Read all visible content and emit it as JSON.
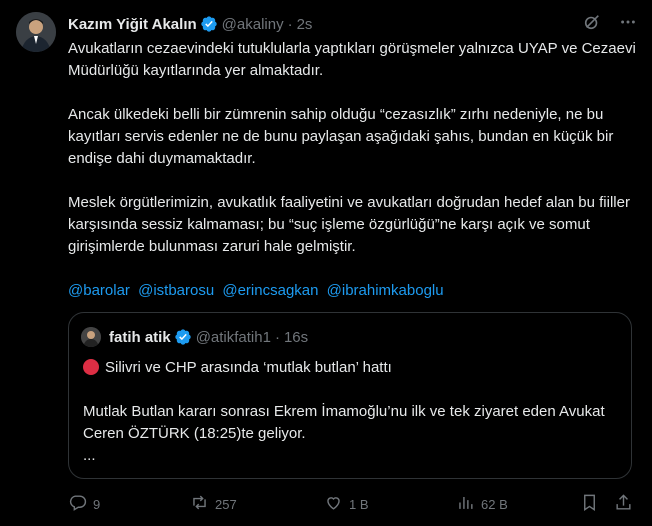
{
  "author": {
    "name": "Kazım Yiğit Akalın",
    "handle": "@akaliny",
    "separator": "·",
    "time": "2s"
  },
  "tweet": {
    "paragraphs": [
      "Avukatların cezaevindeki tutuklularla yaptıkları görüşmeler yalnızca UYAP ve Cezaevi Müdürlüğü kayıtlarında yer almaktadır.",
      "Ancak ülkedeki belli bir zümrenin sahip olduğu “cezasızlık” zırhı nedeniyle, ne bu kayıtları servis edenler ne de bunu paylaşan aşağıdaki şahıs, bundan en küçük bir endişe dahi duymamaktadır.",
      "Meslek örgütlerimizin, avukatlık faaliyetini ve avukatları doğrudan hedef alan bu fiiller karşısında sessiz kalmaması; bu “suç işleme özgürlüğü”ne karşı açık ve somut girişimlerde bulunması zaruri hale gelmiştir."
    ],
    "mentions": [
      "@barolar",
      "@istbarosu",
      "@erincsagkan",
      "@ibrahimkaboglu"
    ]
  },
  "quoted": {
    "name": "fatih atik",
    "handle": "@atikfatih1",
    "separator": "·",
    "time": "16s",
    "line1": "Silivri ve CHP arasında ‘mutlak butlan’ hattı",
    "line2": "Mutlak Butlan kararı sonrası Ekrem İmamoğlu’nu ilk ve tek ziyaret eden Avukat Ceren ÖZTÜRK (18:25)te geliyor.",
    "ellipsis": "..."
  },
  "actions": {
    "replies": "9",
    "reposts": "257",
    "likes": "1 B",
    "views": "62 B"
  },
  "colors": {
    "background": "#000000",
    "text": "#e7e9ea",
    "muted": "#71767b",
    "link": "#1d9bf0",
    "verified": "#1d9bf0",
    "red_dot": "#dd2e44",
    "border": "#2f3336"
  },
  "icons": [
    "grok-icon",
    "more-icon",
    "verified-badge-icon",
    "red-circle-emoji",
    "reply-icon",
    "repost-icon",
    "like-icon",
    "views-icon",
    "bookmark-icon",
    "share-icon"
  ]
}
